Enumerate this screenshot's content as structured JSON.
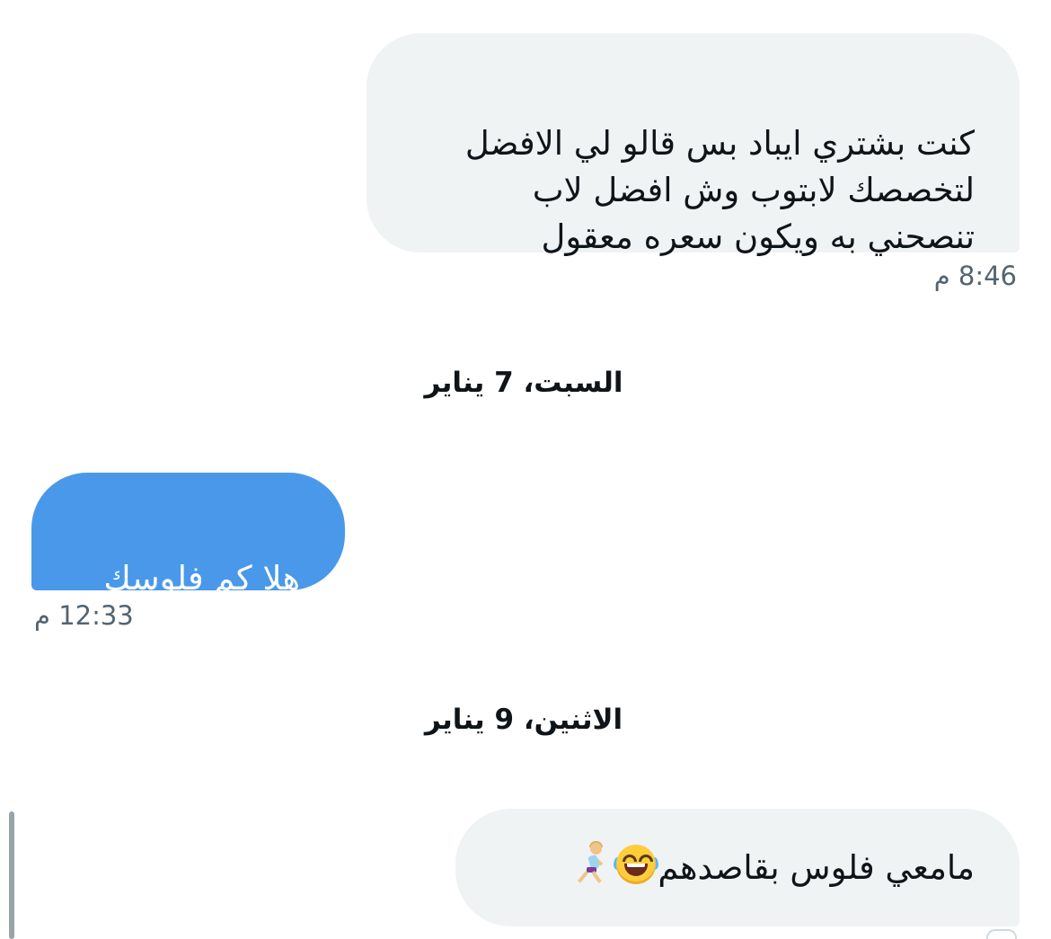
{
  "messages": [
    {
      "sender": "them",
      "text": "كنت بشتري ايباد بس قالو لي الافضل\nلتخصصك لابتوب وش افضل لاب\nتنصحني به ويكون سعره معقول",
      "time": "8:46 م"
    },
    {
      "sender": "me",
      "text": "هلا كم فلوسك",
      "time": "12:33 م"
    },
    {
      "sender": "them",
      "text": "مامعي فلوس بقاصدهم",
      "emoji": [
        "face-with-tears-of-joy-icon",
        "woman-running-icon"
      ],
      "time": ""
    }
  ],
  "date_separators": [
    "السبت، 7 يناير",
    "الاثنين، 9 يناير"
  ],
  "colors": {
    "incoming_bubble": "#eff3f4",
    "outgoing_bubble": "#4a98e9",
    "incoming_text": "#0f1419",
    "outgoing_text": "#ffffff",
    "timestamp": "#536471"
  }
}
